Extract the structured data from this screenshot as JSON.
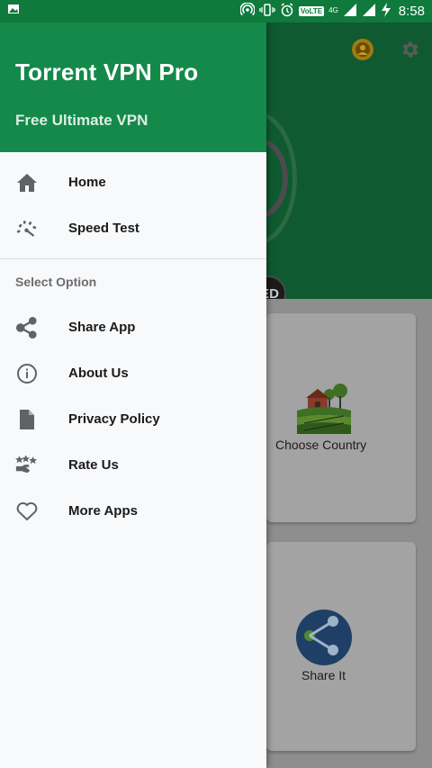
{
  "status_bar": {
    "time": "8:58",
    "network_badge": "VoLTE",
    "network_type": "4G",
    "icons": [
      "image-notification-icon",
      "hotspot-icon",
      "vibrate-icon",
      "alarm-icon",
      "signal-icon",
      "signal-icon",
      "charging-icon"
    ]
  },
  "drawer": {
    "title": "Torrent VPN Pro",
    "subtitle": "Free Ultimate VPN",
    "primary_items": [
      {
        "label": "Home",
        "icon": "home-icon"
      },
      {
        "label": "Speed Test",
        "icon": "speedometer-icon"
      }
    ],
    "section_title": "Select Option",
    "option_items": [
      {
        "label": "Share App",
        "icon": "share-icon"
      },
      {
        "label": "About Us",
        "icon": "info-icon"
      },
      {
        "label": "Privacy Policy",
        "icon": "document-icon"
      },
      {
        "label": "Rate Us",
        "icon": "rate-stars-icon"
      },
      {
        "label": "More Apps",
        "icon": "heart-icon"
      }
    ]
  },
  "background": {
    "connection_label": "ED",
    "cards": [
      {
        "label": "Choose Country",
        "icon": "farm-landscape-icon"
      },
      {
        "label": "Share It",
        "icon": "share-circle-icon"
      }
    ],
    "top_icons": [
      "avatar-icon",
      "gear-icon"
    ]
  },
  "colors": {
    "status_bar": "#0f7a3c",
    "drawer_header": "#14894a",
    "drawer_bg": "#f8f9fb",
    "scrim_dim": "#0f5a30"
  }
}
